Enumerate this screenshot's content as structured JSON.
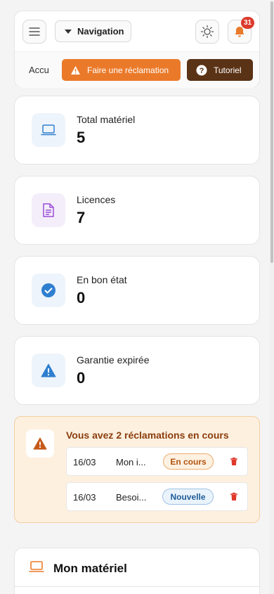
{
  "header": {
    "nav_label": "Navigation",
    "notification_count": "31",
    "breadcrumb": "Accu",
    "claim_button": "Faire une réclamation",
    "tutorial_button": "Tutoriel"
  },
  "stats": [
    {
      "label": "Total matériel",
      "value": "5",
      "icon": "laptop-icon",
      "color": "#2f7fd0"
    },
    {
      "label": "Licences",
      "value": "7",
      "icon": "document-icon",
      "color": "#9b4fd6"
    },
    {
      "label": "En bon état",
      "value": "0",
      "icon": "check-circle-icon",
      "color": "#2f7fd0"
    },
    {
      "label": "Garantie expirée",
      "value": "0",
      "icon": "warning-icon",
      "color": "#2f7fd0"
    }
  ],
  "claims_alert": {
    "title": "Vous avez 2 réclamations en cours",
    "items": [
      {
        "date": "16/03",
        "title": "Mon i...",
        "status": "En cours"
      },
      {
        "date": "16/03",
        "title": "Besoi...",
        "status": "Nouvelle"
      }
    ]
  },
  "materiel_section": {
    "title": "Mon matériel"
  },
  "colors": {
    "accent": "#ea7a2a",
    "brown": "#5a3215",
    "danger": "#dc3a2b"
  }
}
